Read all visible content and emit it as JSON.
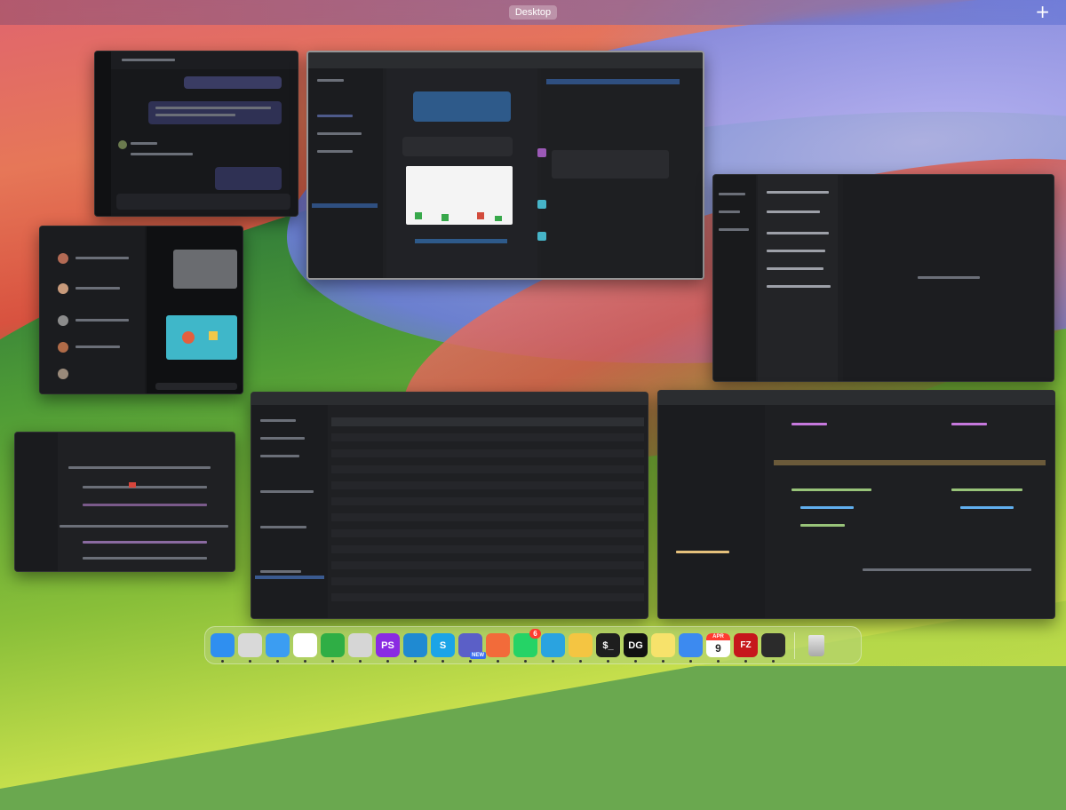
{
  "spaces_bar": {
    "desktop_label": "Desktop",
    "add_label": "+"
  },
  "windows": [
    {
      "name": "chat-window"
    },
    {
      "name": "ide-window"
    },
    {
      "name": "editor-window"
    },
    {
      "name": "messenger-window"
    },
    {
      "name": "spreadsheet-window"
    },
    {
      "name": "database-window"
    },
    {
      "name": "code-editor-window"
    }
  ],
  "dock": {
    "items": [
      {
        "name": "finder",
        "icon": "finder-icon",
        "label": "",
        "color": "#2f8ff0"
      },
      {
        "name": "launchpad",
        "icon": "launchpad-icon",
        "label": "",
        "color": "#d9d9d9"
      },
      {
        "name": "safari",
        "icon": "safari-icon",
        "label": "",
        "color": "#3b9df2"
      },
      {
        "name": "chrome",
        "icon": "chrome-icon",
        "label": "",
        "color": "#ffffff"
      },
      {
        "name": "numbers",
        "icon": "numbers-icon",
        "label": "",
        "color": "#2fae45"
      },
      {
        "name": "affinity",
        "icon": "affinity-icon",
        "label": "",
        "color": "#d6d6d6"
      },
      {
        "name": "phpstorm",
        "icon": "phpstorm-icon",
        "label": "PS",
        "color": "#8a2be2"
      },
      {
        "name": "vscode",
        "icon": "vscode-icon",
        "label": "",
        "color": "#1f8ad2"
      },
      {
        "name": "skype",
        "icon": "skype-icon",
        "label": "S",
        "color": "#1ba4e7"
      },
      {
        "name": "teams",
        "icon": "teams-icon",
        "label": "",
        "color": "#5b5fc7",
        "tag": "NEW"
      },
      {
        "name": "pencil-app",
        "icon": "pencil-icon",
        "label": "",
        "color": "#f26b3a"
      },
      {
        "name": "whatsapp",
        "icon": "whatsapp-icon",
        "label": "",
        "color": "#25d366",
        "badge": "6"
      },
      {
        "name": "telegram",
        "icon": "telegram-icon",
        "label": "",
        "color": "#2aa3e0"
      },
      {
        "name": "cyberduck",
        "icon": "cyberduck-icon",
        "label": "",
        "color": "#f4c542"
      },
      {
        "name": "terminal",
        "icon": "terminal-icon",
        "label": "$_",
        "color": "#1e1e1e"
      },
      {
        "name": "datagrip",
        "icon": "datagrip-icon",
        "label": "DG",
        "color": "#111111"
      },
      {
        "name": "notes",
        "icon": "notes-icon",
        "label": "",
        "color": "#f7e26b"
      },
      {
        "name": "mail",
        "icon": "mail-icon",
        "label": "",
        "color": "#3c8af0"
      },
      {
        "name": "calendar",
        "icon": "calendar-icon",
        "label": "9",
        "month": "APR",
        "color": "#ffffff"
      },
      {
        "name": "filezilla",
        "icon": "filezilla-icon",
        "label": "FZ",
        "color": "#c6171c"
      },
      {
        "name": "activity-monitor",
        "icon": "activity-monitor-icon",
        "label": "",
        "color": "#2b2b2b"
      }
    ],
    "trash": {
      "name": "trash",
      "icon": "trash-icon"
    }
  }
}
